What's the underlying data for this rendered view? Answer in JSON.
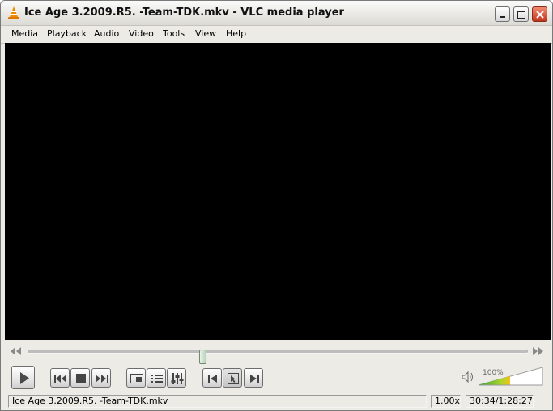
{
  "window": {
    "title": "Ice Age 3.2009.R5. -Team-TDK.mkv - VLC media player",
    "app_icon": "vlc-cone-icon",
    "controls": [
      "minimize-icon",
      "maximize-icon",
      "close-icon"
    ]
  },
  "menu": {
    "items": [
      "Media",
      "Playback",
      "Audio",
      "Video",
      "Tools",
      "View",
      "Help"
    ]
  },
  "seek": {
    "position": 0.35,
    "elapsed": "30:34",
    "duration": "1:28:27"
  },
  "controls": {
    "buttons": [
      "play-icon",
      "previous-icon",
      "stop-icon",
      "next-icon",
      "fullscreen-icon",
      "playlist-icon",
      "extended-settings-icon",
      "frame-back-icon",
      "snapshot-icon",
      "frame-forward-icon"
    ]
  },
  "volume": {
    "label": "100%",
    "level": 1.0,
    "icon": "speaker-icon"
  },
  "status": {
    "filename": "Ice Age 3.2009.R5. -Team-TDK.mkv",
    "speed": "1.00x",
    "time": "30:34/1:28:27"
  },
  "colors": {
    "video_bg": "#000000",
    "volume_low": "#3aa33a",
    "volume_high": "#f2c21a"
  }
}
